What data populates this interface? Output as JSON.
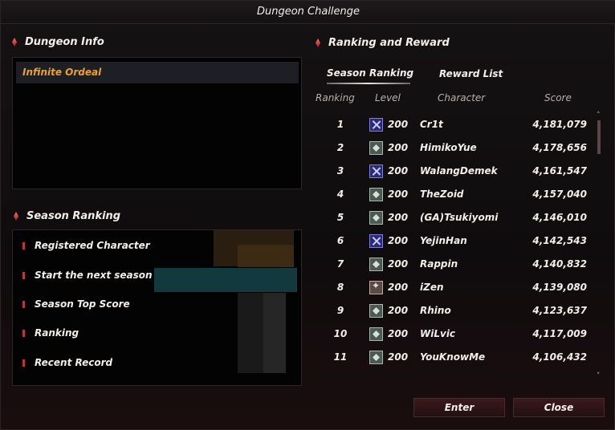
{
  "window": {
    "title": "Dungeon Challenge"
  },
  "dungeon_info": {
    "heading": "Dungeon Info",
    "selected_item": "Infinite Ordeal"
  },
  "season_ranking": {
    "heading": "Season Ranking",
    "items": [
      "Registered Character",
      "Start the next season",
      "Season Top Score",
      "Ranking",
      "Recent Record"
    ]
  },
  "ranking_reward": {
    "heading": "Ranking and Reward",
    "tabs": [
      {
        "label": "Season Ranking",
        "active": true
      },
      {
        "label": "Reward List",
        "active": false
      }
    ],
    "columns": [
      "Ranking",
      "Level",
      "Character",
      "Score"
    ],
    "rows": [
      {
        "rank": "1",
        "icon": "cross-class-icon",
        "level": "200",
        "character": "Cr1t",
        "score": "4,181,079"
      },
      {
        "rank": "2",
        "icon": "shield-class-icon",
        "level": "200",
        "character": "HimikoYue",
        "score": "4,178,656"
      },
      {
        "rank": "3",
        "icon": "cross-class-icon",
        "level": "200",
        "character": "WalangDemek",
        "score": "4,161,547"
      },
      {
        "rank": "4",
        "icon": "shield-class-icon",
        "level": "200",
        "character": "TheZoid",
        "score": "4,157,040"
      },
      {
        "rank": "5",
        "icon": "shield-class-icon",
        "level": "200",
        "character": "(GA)Tsukiyomi",
        "score": "4,146,010"
      },
      {
        "rank": "6",
        "icon": "cross-class-icon",
        "level": "200",
        "character": "YejinHan",
        "score": "4,142,543"
      },
      {
        "rank": "7",
        "icon": "shield-class-icon",
        "level": "200",
        "character": "Rappin",
        "score": "4,140,832"
      },
      {
        "rank": "8",
        "icon": "star-class-icon",
        "level": "200",
        "character": "iZen",
        "score": "4,139,080"
      },
      {
        "rank": "9",
        "icon": "shield-class-icon",
        "level": "200",
        "character": "Rhino",
        "score": "4,123,637"
      },
      {
        "rank": "10",
        "icon": "shield-class-icon",
        "level": "200",
        "character": "WiLvic",
        "score": "4,117,009"
      },
      {
        "rank": "11",
        "icon": "shield-class-icon",
        "level": "200",
        "character": "YouKnowMe",
        "score": "4,106,432"
      }
    ]
  },
  "buttons": {
    "enter": "Enter",
    "close": "Close"
  },
  "colors": {
    "accent_red": "#c03535",
    "selected_text": "#f0a020"
  }
}
